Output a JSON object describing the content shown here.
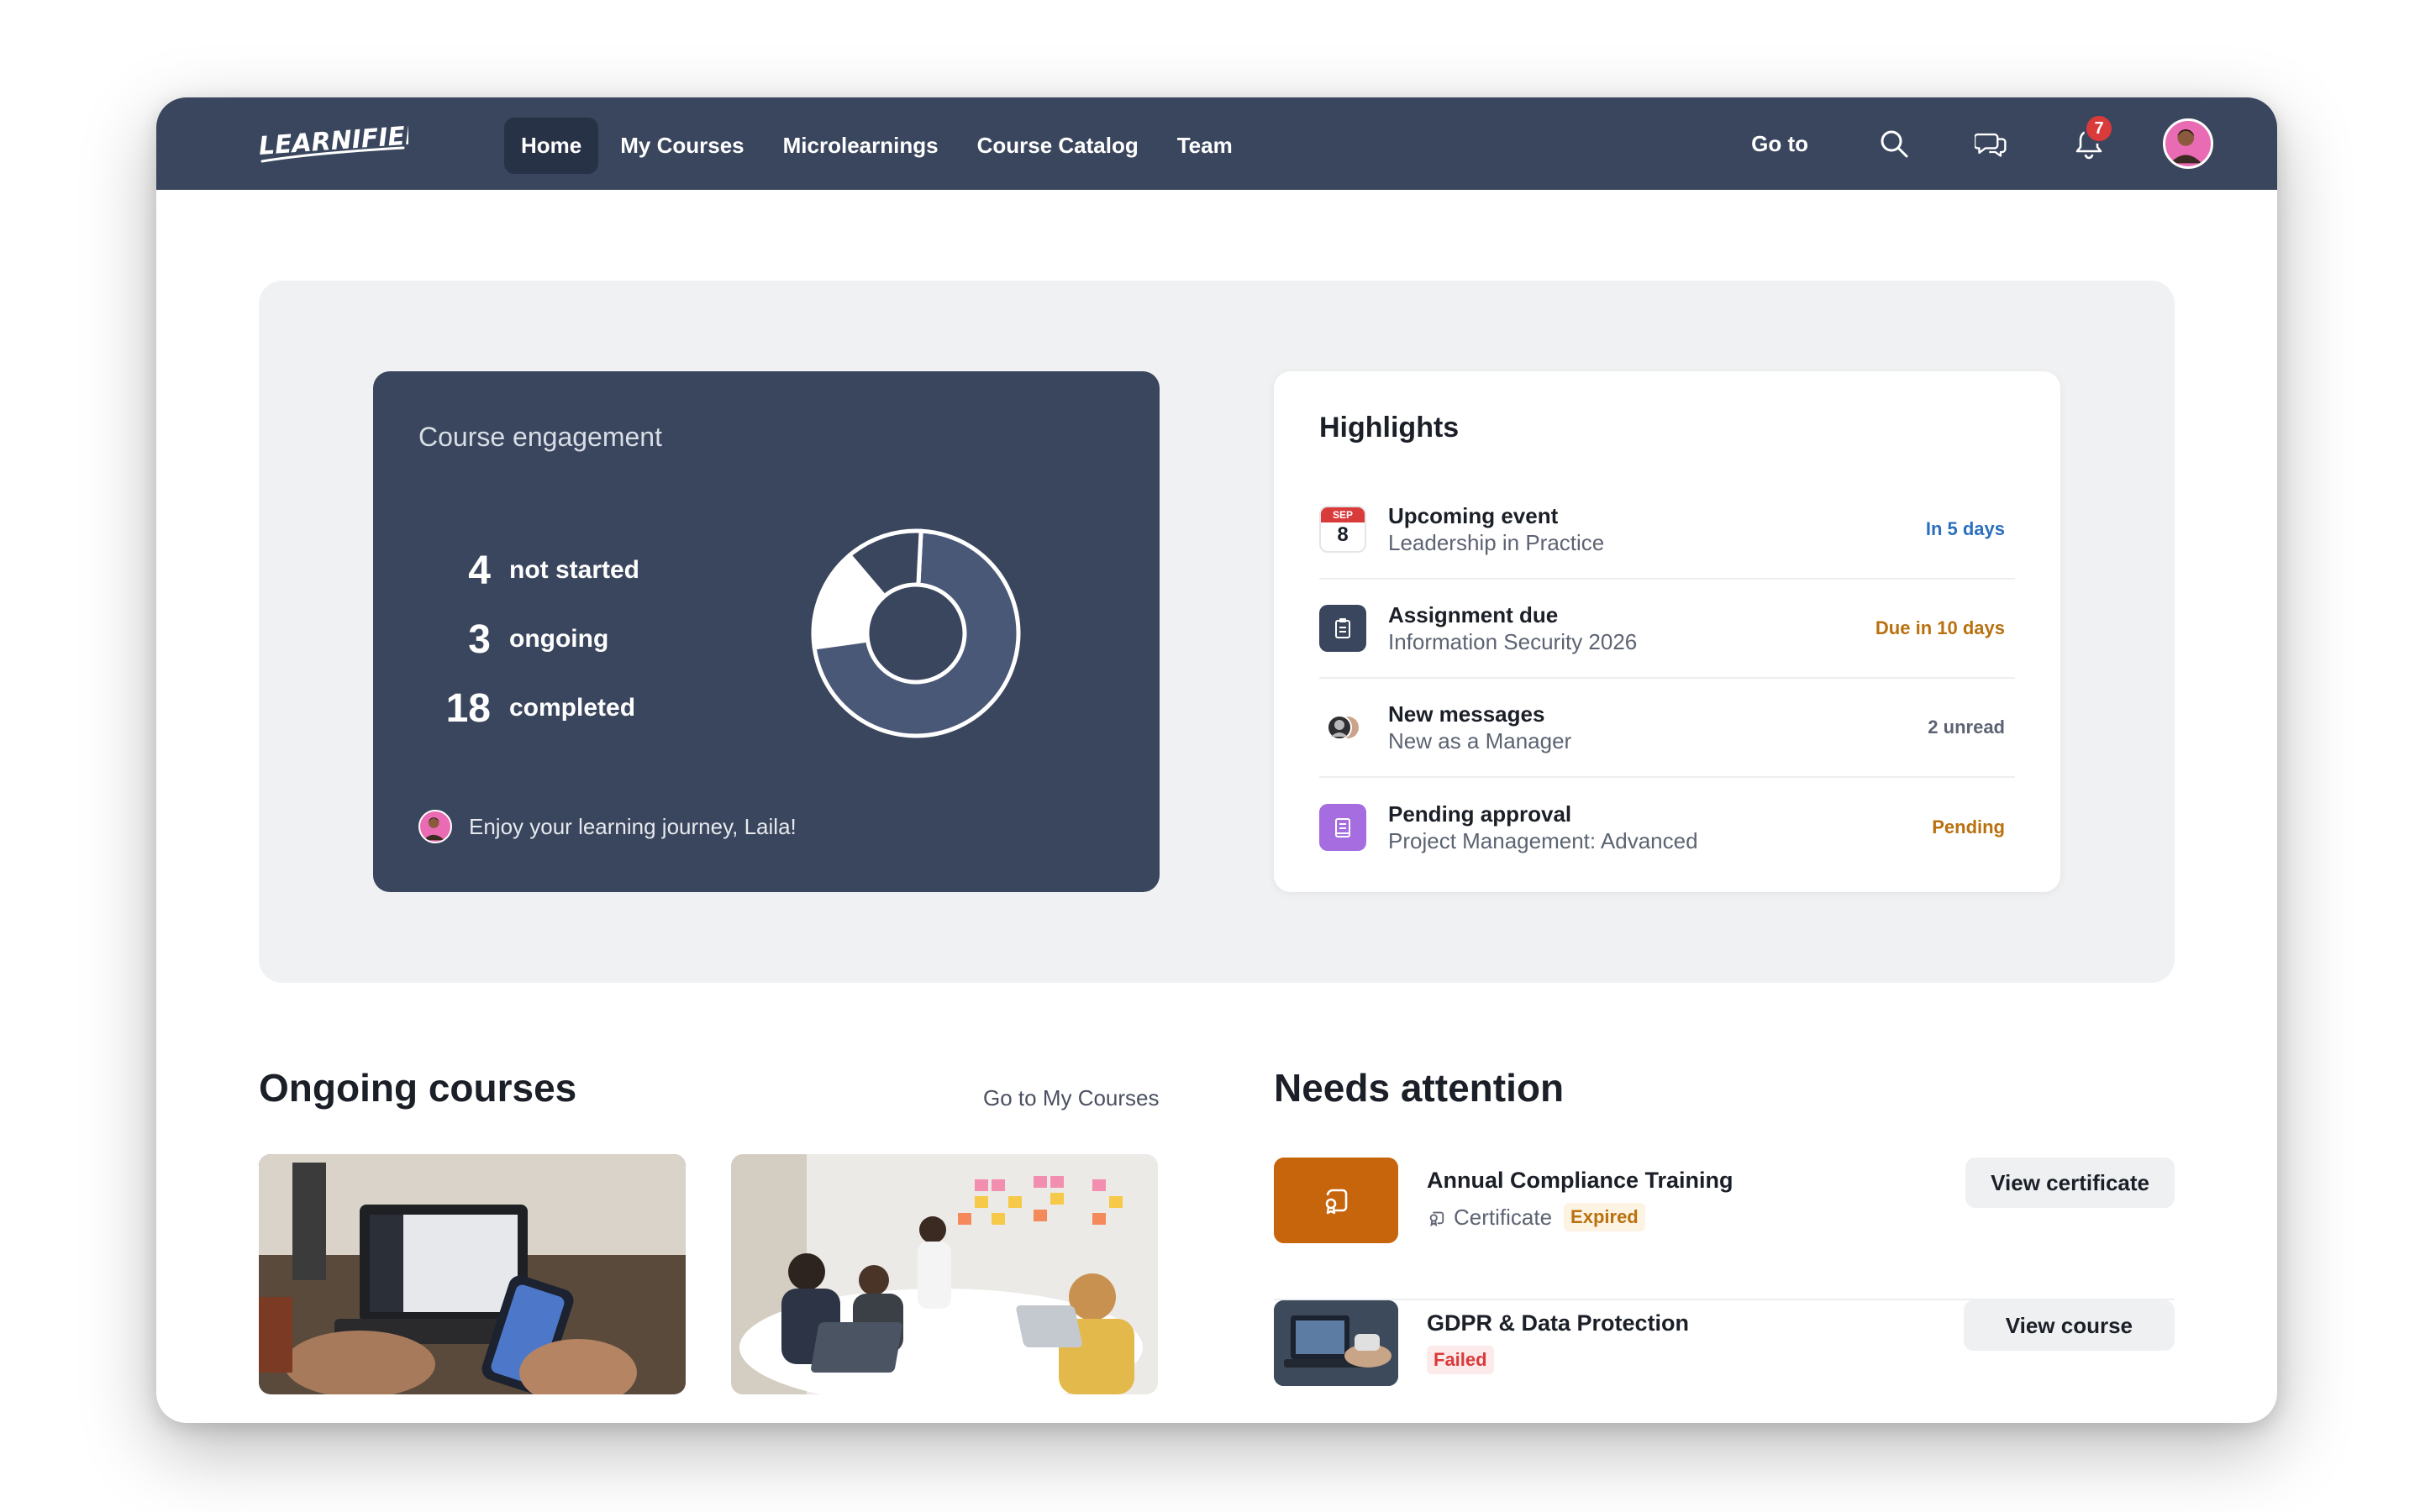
{
  "nav": {
    "logo_text": "LEARNIFIER",
    "links": [
      "Home",
      "My Courses",
      "Microlearnings",
      "Course Catalog",
      "Team"
    ],
    "goto_label": "Go to",
    "notification_count": "7",
    "icons": [
      "search-icon",
      "chat-icon",
      "bell-icon"
    ]
  },
  "engagement": {
    "title": "Course engagement",
    "stats": [
      {
        "count": "4",
        "label": "not started"
      },
      {
        "count": "3",
        "label": "ongoing"
      },
      {
        "count": "18",
        "label": "completed"
      }
    ],
    "footer": "Enjoy your learning journey, Laila!"
  },
  "highlights": {
    "title": "Highlights",
    "items": [
      {
        "name": "Upcoming event",
        "sub": "Leadership in Practice",
        "status": "In 5 days",
        "icon": "calendar-icon",
        "cal_month": "SEP",
        "cal_day": "8"
      },
      {
        "name": "Assignment due",
        "sub": "Information Security 2026",
        "status": "Due in 10 days",
        "icon": "clipboard-icon"
      },
      {
        "name": "New messages",
        "sub": "New as a Manager",
        "status": "2 unread",
        "icon": "people-icon"
      },
      {
        "name": "Pending approval",
        "sub": "Project Management: Advanced",
        "status": "Pending",
        "icon": "book-icon"
      }
    ]
  },
  "ongoing": {
    "title": "Ongoing courses",
    "link": "Go to My Courses"
  },
  "attention": {
    "title": "Needs attention",
    "items": [
      {
        "name": "Annual Compliance Training",
        "meta": "Certificate",
        "tag": "Expired",
        "button": "View certificate"
      },
      {
        "name": "GDPR & Data Protection",
        "meta": "",
        "tag": "Failed",
        "button": "View course"
      }
    ]
  },
  "colors": {
    "nav_bg": "#3a465d",
    "accent_blue": "#2a6fbd",
    "accent_orange": "#b9700e",
    "danger": "#d93a3a",
    "purple": "#a56de0"
  }
}
